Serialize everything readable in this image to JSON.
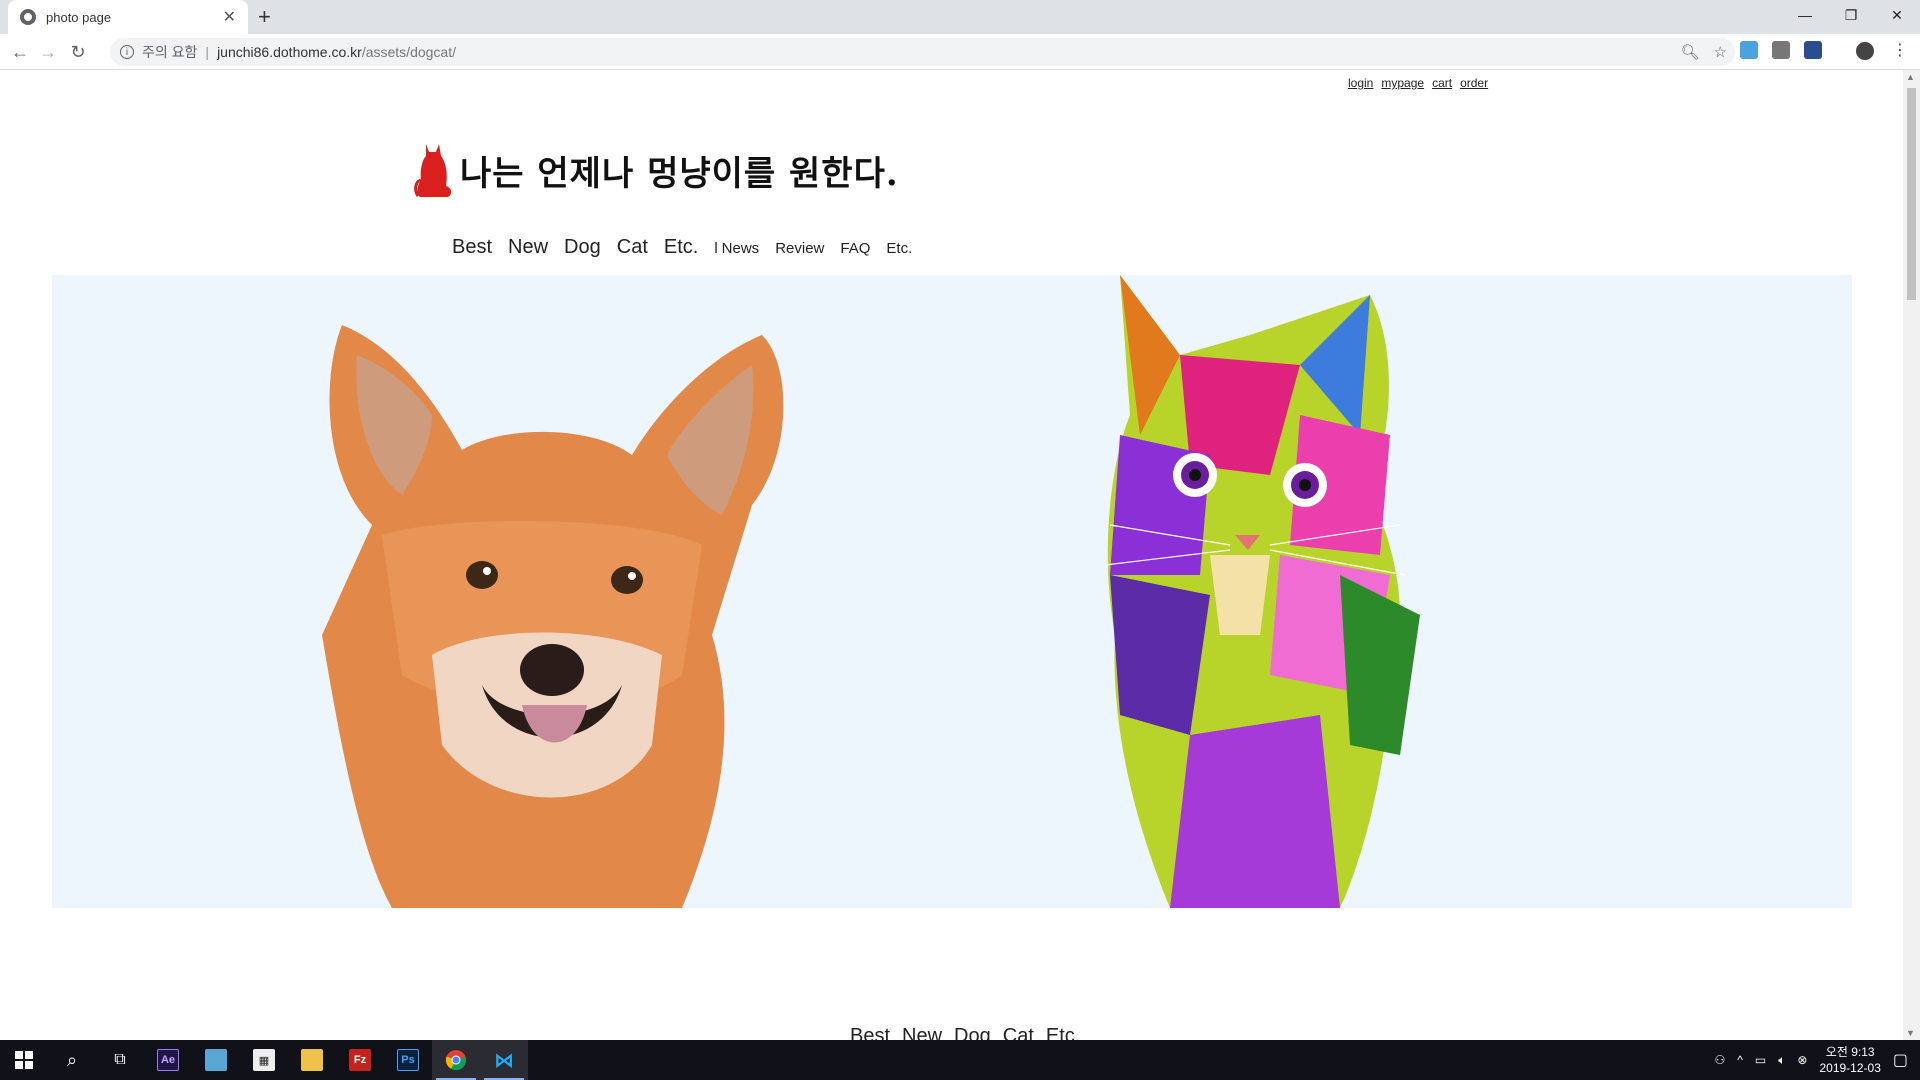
{
  "browser": {
    "tab_title": "photo page",
    "address_warning": "주의 요함",
    "address_domain": "junchi86.dothome.co.kr",
    "address_path": "/assets/dogcat/"
  },
  "page": {
    "util_links": [
      "login",
      "mypage",
      "cart",
      "order"
    ],
    "logo_text": "나는 언제나 멍냥이를 원한다.",
    "nav": {
      "best": "Best",
      "new": "New",
      "dog": "Dog",
      "cat": "Cat",
      "etc": "Etc.",
      "bar": "l",
      "news": "News",
      "review": "Review",
      "faq": "FAQ",
      "etc2": "Etc."
    },
    "bottom_nav": [
      "Best",
      "New",
      "Dog",
      "Cat",
      "Etc."
    ]
  },
  "taskbar": {
    "time": "오전 9:13",
    "date": "2019-12-03"
  },
  "colors": {
    "hero_bg": "#eef6fd",
    "taskbar_bg": "#111219",
    "logo_cat": "#d9201f"
  }
}
